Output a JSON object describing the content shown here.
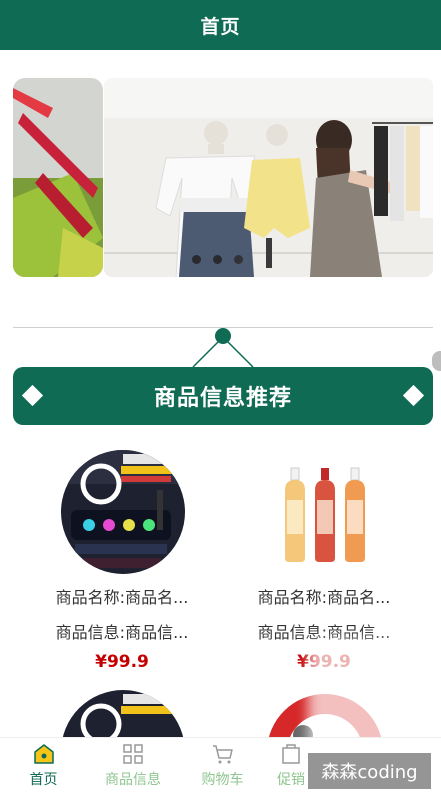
{
  "header": {
    "title": "首页"
  },
  "carousel": {
    "slides": [
      "left-slide",
      "main-slide"
    ],
    "dots": 3,
    "active_dot": 2
  },
  "section": {
    "title": "商品信息推荐"
  },
  "products": [
    {
      "name": "商品名称:商品名...",
      "info": "商品信息:商品信...",
      "price": "¥99.9"
    },
    {
      "name": "商品名称:商品名...",
      "info": "商品信息:商品信...",
      "price": "¥99.9"
    },
    {
      "name": "",
      "info": "",
      "price": ""
    },
    {
      "name": "",
      "info": "",
      "price": ""
    }
  ],
  "tabbar": {
    "items": [
      {
        "label": "首页",
        "icon": "home-icon"
      },
      {
        "label": "商品信息",
        "icon": "grid-icon"
      },
      {
        "label": "购物车",
        "icon": "cart-icon"
      },
      {
        "label": "促销",
        "icon": "promo-icon"
      }
    ]
  },
  "watermark": "森森coding",
  "colors": {
    "primary": "#0f6b54",
    "price": "#c40000",
    "tab_inactive": "#8fc58f"
  }
}
